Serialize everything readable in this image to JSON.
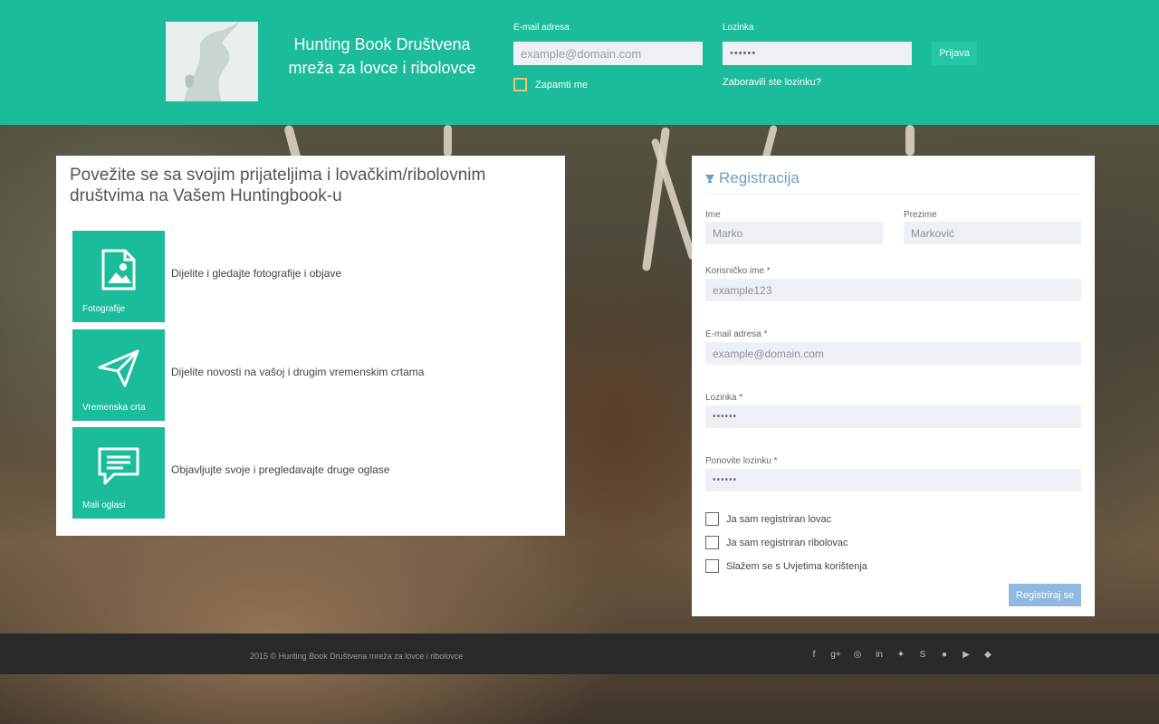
{
  "header": {
    "brand": "Hunting Book Društvena mreža za lovce i ribolovce",
    "email_label": "E-mail adresa",
    "email_placeholder": "example@domain.com",
    "password_label": "Lozinka",
    "password_mask": "••••••",
    "login_button": "Prijava",
    "remember_label": "Zapamti me",
    "forgot_link": "Zaboravili ste lozinku?"
  },
  "intro": {
    "title": "Povežite se sa svojim prijateljima i lovačkim/ribolovnim društvima na Vašem Huntingbook-u",
    "features": [
      {
        "tile": "Fotografije",
        "desc": "Dijelite i gledajte fotografije i objave",
        "icon": "image-icon"
      },
      {
        "tile": "Vremenska crta",
        "desc": "Dijelite novosti na vašoj i drugim vremenskim crtama",
        "icon": "paper-plane-icon"
      },
      {
        "tile": "Mali oglasi",
        "desc": "Objavljujte svoje i pregledavajte druge oglase",
        "icon": "chat-icon"
      }
    ]
  },
  "register": {
    "title": "Registracija",
    "first_name_label": "Ime",
    "first_name_placeholder": "Marko",
    "last_name_label": "Prezime",
    "last_name_placeholder": "Marković",
    "username_label": "Korisničko ime *",
    "username_placeholder": "example123",
    "email_label": "E-mail adresa *",
    "email_placeholder": "example@domain.com",
    "password_label": "Lozinka *",
    "password_mask": "••••••",
    "repeat_label": "Ponovite lozinku *",
    "repeat_mask": "••••••",
    "check_hunter": "Ja sam registriran lovac",
    "check_fisher": "Ja sam registriran ribolovac",
    "check_terms": "Slažem se s Uvjetima korištenja",
    "submit": "Registriraj se"
  },
  "footer": {
    "copyright": "2015 © Hunting Book Društvena mreža za lovce i ribolovce",
    "social_icons": [
      "facebook-icon",
      "google-plus-icon",
      "dribbble-icon",
      "linkedin-icon",
      "twitter-icon",
      "skype-icon",
      "github-icon",
      "youtube-icon",
      "dropbox-icon"
    ]
  },
  "colors": {
    "accent": "#1abc9c",
    "register_button": "#8fb9e0",
    "footer": "#2a2a2c"
  }
}
